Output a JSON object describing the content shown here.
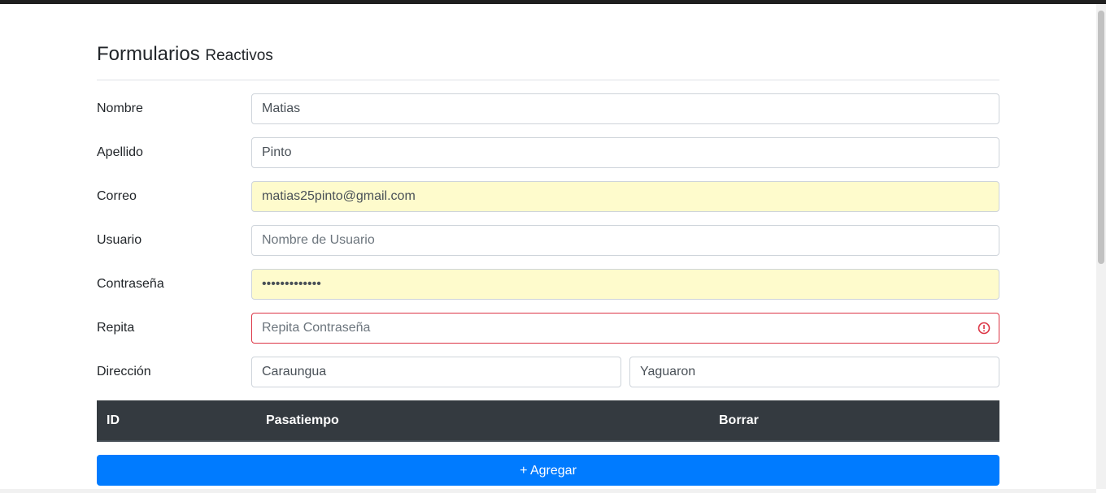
{
  "header": {
    "title": "Formularios",
    "subtitle": "Reactivos"
  },
  "form": {
    "nombre": {
      "label": "Nombre",
      "value": "Matias",
      "placeholder": ""
    },
    "apellido": {
      "label": "Apellido",
      "value": "Pinto",
      "placeholder": ""
    },
    "correo": {
      "label": "Correo",
      "value": "matias25pinto@gmail.com",
      "placeholder": ""
    },
    "usuario": {
      "label": "Usuario",
      "value": "",
      "placeholder": "Nombre de Usuario"
    },
    "contrasena": {
      "label": "Contraseña",
      "value": "•••••••••••••",
      "placeholder": ""
    },
    "repita": {
      "label": "Repita",
      "value": "",
      "placeholder": "Repita Contraseña"
    },
    "direccion": {
      "label": "Dirección",
      "distrito": "Caraungua",
      "ciudad": "Yaguaron"
    }
  },
  "table": {
    "headers": [
      "ID",
      "Pasatiempo",
      "Borrar"
    ]
  },
  "add_button": {
    "label": "+ Agregar"
  },
  "colors": {
    "primary": "#007bff",
    "danger": "#dc3545",
    "table_dark": "#343a40",
    "autofill": "#fefbcc"
  }
}
